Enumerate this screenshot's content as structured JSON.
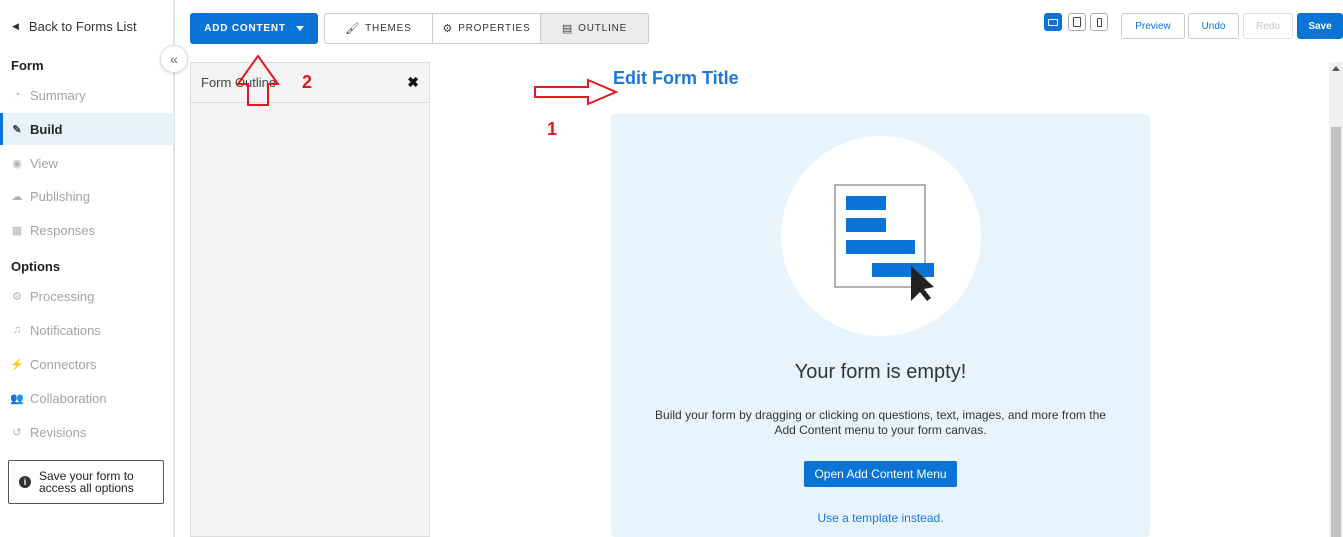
{
  "sidebar": {
    "back_label": "Back to Forms List",
    "form_heading": "Form",
    "form_items": [
      {
        "label": "Summary",
        "icon": "dashboard-icon"
      },
      {
        "label": "Build",
        "icon": "pencil-icon"
      },
      {
        "label": "View",
        "icon": "eye-icon"
      },
      {
        "label": "Publishing",
        "icon": "cloud-upload-icon"
      },
      {
        "label": "Responses",
        "icon": "table-icon"
      }
    ],
    "options_heading": "Options",
    "option_items": [
      {
        "label": "Processing",
        "icon": "gears-icon"
      },
      {
        "label": "Notifications",
        "icon": "bell-icon"
      },
      {
        "label": "Connectors",
        "icon": "plug-icon"
      },
      {
        "label": "Collaboration",
        "icon": "users-icon"
      },
      {
        "label": "Revisions",
        "icon": "history-icon"
      }
    ],
    "active_item": "Build",
    "save_note": "Save your form to access all options",
    "collapse_glyph": "«"
  },
  "toolbar": {
    "add_content_label": "ADD CONTENT",
    "tabs": [
      {
        "label": "THEMES",
        "icon": "brush-icon",
        "glyph": "🖌"
      },
      {
        "label": "PROPERTIES",
        "icon": "gear-icon",
        "glyph": "⚙"
      },
      {
        "label": "OUTLINE",
        "icon": "map-icon",
        "glyph": "▤"
      }
    ],
    "active_tab": "OUTLINE",
    "preview_label": "Preview",
    "undo_label": "Undo",
    "redo_label": "Redo",
    "save_label": "Save"
  },
  "outline": {
    "title": "Form Outline",
    "close_glyph": "✖"
  },
  "canvas": {
    "form_title": "Edit Form Title",
    "empty_heading": "Your form is empty!",
    "empty_body": "Build your form by dragging or clicking on questions, text, images, and more from the Add Content menu to your form canvas.",
    "open_menu_label": "Open Add Content Menu",
    "template_link": "Use a template instead."
  },
  "annotations": {
    "label_1": "1",
    "label_2": "2"
  },
  "colors": {
    "accent": "#0a74d6",
    "annotation": "#e0191f",
    "card_bg": "#e8f4fd"
  }
}
